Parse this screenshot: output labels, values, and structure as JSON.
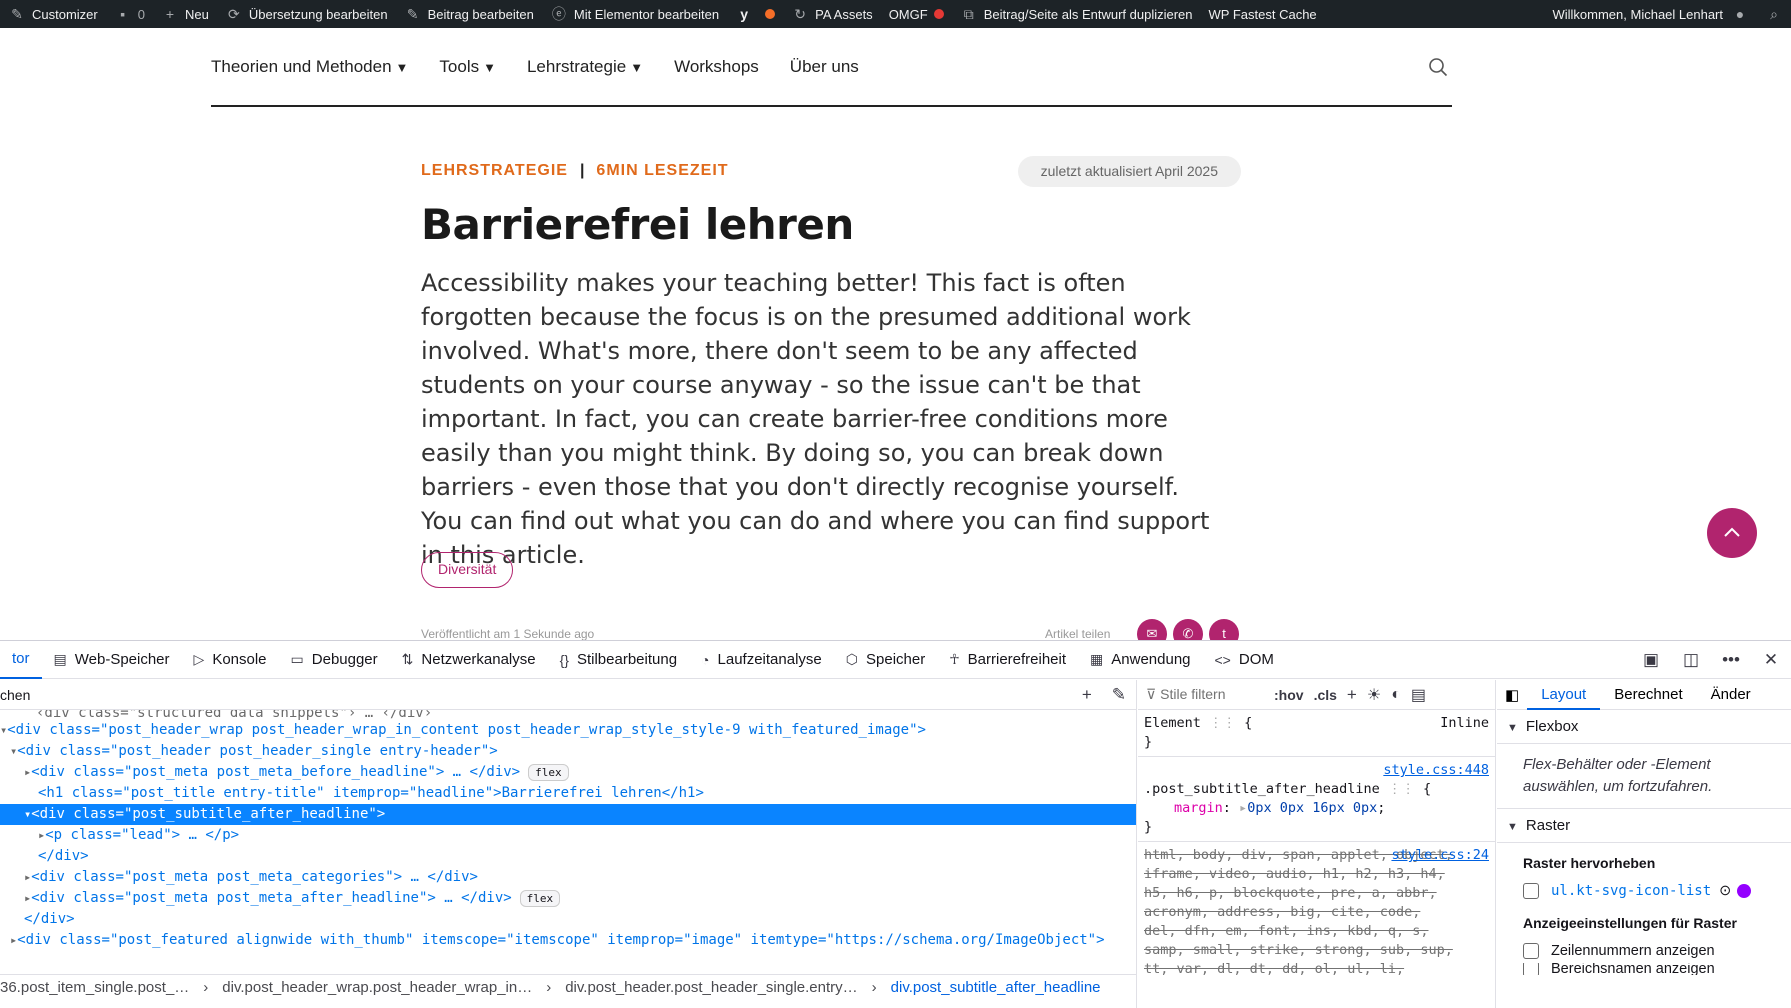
{
  "adminbar": {
    "items": [
      {
        "label": "Customizer",
        "icon": "brush-icon"
      },
      {
        "label": "0",
        "icon": "comment-icon"
      },
      {
        "label": "Neu",
        "icon": "plus-icon"
      },
      {
        "label": "Übersetzung bearbeiten",
        "icon": "translate-icon"
      },
      {
        "label": "Beitrag bearbeiten",
        "icon": "pencil-icon"
      },
      {
        "label": "Mit Elementor bearbeiten",
        "icon": "elementor-icon"
      },
      {
        "label": "",
        "icon": "yoast-icon"
      },
      {
        "label": "PA Assets",
        "icon": "refresh-icon"
      },
      {
        "label": "OMGF",
        "icon": ""
      },
      {
        "label": "Beitrag/Seite als Entwurf duplizieren",
        "icon": "copy-icon"
      },
      {
        "label": "WP Fastest Cache",
        "icon": ""
      }
    ],
    "welcome": "Willkommen, Michael Lenhart",
    "status_colors": {
      "yoast": "#f56e28",
      "omgf": "#e53935"
    }
  },
  "nav": {
    "items": [
      "Theorien und Methoden",
      "Tools",
      "Lehrstrategie",
      "Workshops",
      "Über uns"
    ],
    "caret": "▼"
  },
  "article": {
    "category": "LEHRSTRATEGIE",
    "separator": "|",
    "reading_time": "6MIN LESEZEIT",
    "updated": "zuletzt aktualisiert April 2025",
    "title": "Barrierefrei lehren",
    "lead": "Accessibility makes your teaching better! This fact is often forgotten because the focus is on the presumed additional work involved. What's more, there don't seem to be any affected students on your course anyway - so the issue can't be that important. In fact, you can create barrier-free conditions more easily than you might think. By doing so, you can break down barriers - even those that you don't directly recognise yourself. You can find out what you can do and where you can find support in this article.",
    "tag": "Diversität",
    "published": "Veröffentlicht am 1 Sekunde ago",
    "share_label": "Artikel teilen",
    "accent": "#b1246e",
    "category_color": "#e06a1b"
  },
  "devtools": {
    "tabs": [
      {
        "label": "tor",
        "icon": ""
      },
      {
        "label": "Web-Speicher",
        "icon": "storage-icon"
      },
      {
        "label": "Konsole",
        "icon": "console-icon"
      },
      {
        "label": "Debugger",
        "icon": "debugger-icon"
      },
      {
        "label": "Netzwerkanalyse",
        "icon": "network-icon"
      },
      {
        "label": "Stilbearbeitung",
        "icon": "braces-icon"
      },
      {
        "label": "Laufzeitanalyse",
        "icon": "gauge-icon"
      },
      {
        "label": "Speicher",
        "icon": "memory-icon"
      },
      {
        "label": "Barrierefreiheit",
        "icon": "accessibility-icon"
      },
      {
        "label": "Anwendung",
        "icon": "grid-icon"
      },
      {
        "label": "DOM",
        "icon": "code-icon"
      }
    ],
    "markup_search": "chen",
    "code": [
      "‹div class=\"structured_data_snippets\"› … ‹/div›",
      "<div class=\"post_header_wrap post_header_wrap_in_content post_header_wrap_style_style-9 with_featured_image\">",
      "<div class=\"post_header post_header_single entry-header\">",
      "<div class=\"post_meta post_meta_before_headline\"> … </div>",
      "<h1 class=\"post_title entry-title\" itemprop=\"headline\">Barrierefrei lehren</h1>",
      "<div class=\"post_subtitle_after_headline\">",
      "<p class=\"lead\"> … </p>",
      "</div>",
      "<div class=\"post_meta post_meta_categories\"> … </div>",
      "<div class=\"post_meta post_meta_after_headline\"> … </div>",
      "</div>",
      "<div class=\"post_featured alignwide with_thumb\" itemscope=\"itemscope\" itemprop=\"image\" itemtype=\"https://schema.org/ImageObject\">"
    ],
    "flex_badge": "flex",
    "breadcrumbs": [
      "36.post_item_single.post_…",
      "div.post_header_wrap.post_header_wrap_in…",
      "div.post_header.post_header_single.entry…",
      "div.post_subtitle_after_headline"
    ],
    "rules": {
      "filter_placeholder": "Stile filtern",
      "hov": ":hov",
      "cls": ".cls",
      "element_label": "Element",
      "inline_label": "Inline",
      "rule1_source": "style.css:448",
      "rule1_selector": ".post_subtitle_after_headline",
      "rule1_prop": "margin",
      "rule1_value": "0px 0px 16px 0px",
      "rule2_source": "style.css:24",
      "rule2_selectors": "html, body, div, span, applet, object, iframe, video, audio, h1, h2, h3, h4, h5, h6, p, blockquote, pre, a, abbr, acronym, address, big, cite, code, del, dfn, em, font, ins, kbd, q, s, samp, small, strike, strong, sub, sup, tt, var, dl, dt, dd, ol, ul, li, fieldset, form,"
    },
    "layout": {
      "tabs": [
        "Layout",
        "Berechnet",
        "Änder"
      ],
      "flexbox": "Flexbox",
      "flex_note": "Flex-Behälter oder -Element auswählen, um fortzufahren.",
      "grid": "Raster",
      "grid_highlight": "Raster hervorheben",
      "grid_item": "ul.kt-svg-icon-list",
      "grid_settings": "Anzeigeeinstellungen für Raster",
      "line_numbers": "Zeilennummern anzeigen",
      "area_names": "Bereichsnamen anzeigen"
    }
  }
}
